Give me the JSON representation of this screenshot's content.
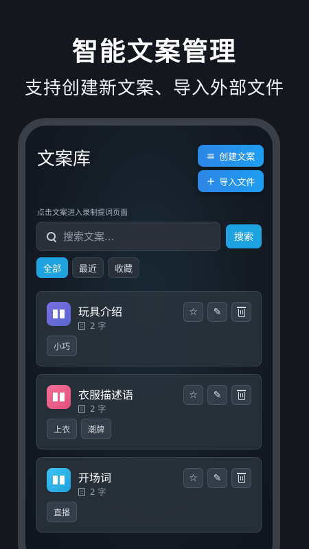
{
  "promo": {
    "headline": "智能文案管理",
    "subline": "支持创建新文案、导入外部文件"
  },
  "app": {
    "title": "文案库",
    "create_label": "创建文案",
    "import_label": "导入文件",
    "import_icon": "+",
    "hint": "点击文案进入录制提词页面"
  },
  "search": {
    "placeholder": "搜索文案...",
    "value": "",
    "button_label": "搜索"
  },
  "filters": [
    {
      "label": "全部",
      "active": true
    },
    {
      "label": "最近",
      "active": false
    },
    {
      "label": "收藏",
      "active": false
    }
  ],
  "scripts": [
    {
      "title": "玩具介绍",
      "meta": "2 字",
      "tags": [
        "小巧"
      ],
      "icon_color": "#6b6fd8"
    },
    {
      "title": "衣服描述语",
      "meta": "2 字",
      "tags": [
        "上衣",
        "潮牌"
      ],
      "icon_color": "#ea5f86"
    },
    {
      "title": "开场词",
      "meta": "2 字",
      "tags": [
        "直播"
      ],
      "icon_color": "#2fb4e6"
    }
  ],
  "actions": {
    "star_icon": "☆",
    "edit_icon": "✎"
  },
  "colors": {
    "accent": "#1fa2e0",
    "background": "#14171d"
  }
}
